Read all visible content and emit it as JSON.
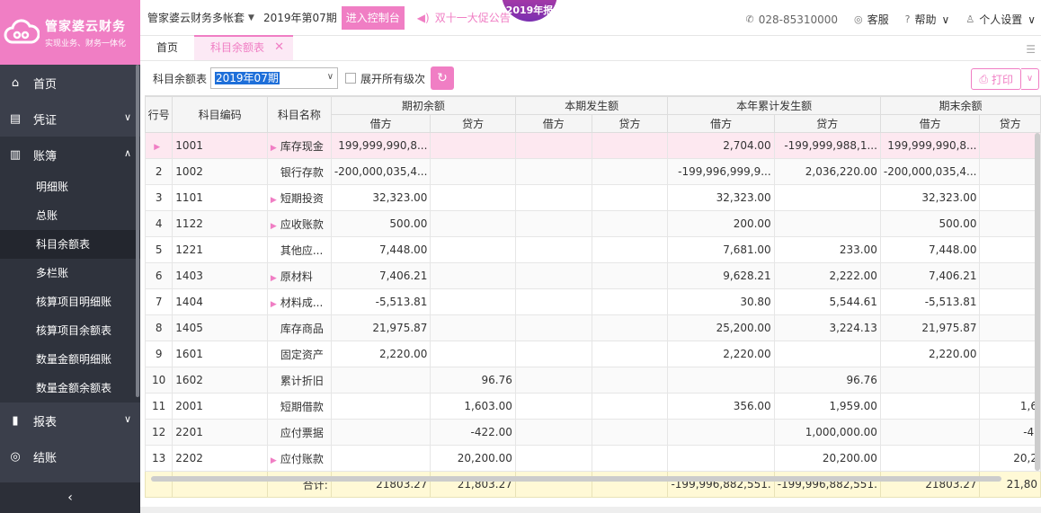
{
  "logo": {
    "title": "管家婆云财务",
    "slogan": "实现业务、财务一体化"
  },
  "sidebar": {
    "items": [
      {
        "label": "首页",
        "icon": "home-icon"
      },
      {
        "label": "凭证",
        "icon": "voucher-icon",
        "chevron": "∨"
      },
      {
        "label": "账簿",
        "icon": "ledger-icon",
        "chevron": "∧"
      }
    ],
    "ledger_sub": [
      "明细账",
      "总账",
      "科目余额表",
      "多栏账",
      "核算项目明细账",
      "核算项目余额表",
      "数量金额明细账",
      "数量金额余额表"
    ],
    "items_after": [
      {
        "label": "报表",
        "icon": "chart-icon",
        "chevron": "∨"
      },
      {
        "label": "结账",
        "icon": "close-account-icon"
      }
    ],
    "collapse": "‹"
  },
  "topbar": {
    "account": "管家婆云财务多帐套",
    "period": "2019年第07期",
    "enter_console": "进入控制台",
    "promo": "双十一大促公告",
    "badge": "2019年报",
    "phone": "028-85310000",
    "service": "客服",
    "help": "帮助",
    "settings": "个人设置"
  },
  "tabs": [
    {
      "label": "首页"
    },
    {
      "label": "科目余额表"
    }
  ],
  "toolbar": {
    "label": "科目余额表",
    "period_value": "2019年07期",
    "expand_label": "展开所有级次",
    "print": "打印"
  },
  "table": {
    "group_headers": [
      "行号",
      "科目编码",
      "科目名称",
      "期初余额",
      "本期发生额",
      "本年累计发生额",
      "期末余额"
    ],
    "sub_headers": [
      "借方",
      "贷方",
      "借方",
      "贷方",
      "借方",
      "贷方",
      "借方",
      "贷方"
    ],
    "rows": [
      {
        "no": "",
        "code": "1001",
        "name": "库存现金",
        "expand": true,
        "v": [
          "199,999,990,8...",
          "",
          "",
          "",
          "2,704.00",
          "-199,999,988,1...",
          "199,999,990,8...",
          ""
        ]
      },
      {
        "no": "2",
        "code": "1002",
        "name": "银行存款",
        "expand": false,
        "v": [
          "-200,000,035,4...",
          "",
          "",
          "",
          "-199,996,999,9...",
          "2,036,220.00",
          "-200,000,035,4...",
          ""
        ]
      },
      {
        "no": "3",
        "code": "1101",
        "name": "短期投资",
        "expand": true,
        "v": [
          "32,323.00",
          "",
          "",
          "",
          "32,323.00",
          "",
          "32,323.00",
          ""
        ]
      },
      {
        "no": "4",
        "code": "1122",
        "name": "应收账款",
        "expand": true,
        "v": [
          "500.00",
          "",
          "",
          "",
          "200.00",
          "",
          "500.00",
          ""
        ]
      },
      {
        "no": "5",
        "code": "1221",
        "name": "其他应...",
        "expand": false,
        "v": [
          "7,448.00",
          "",
          "",
          "",
          "7,681.00",
          "233.00",
          "7,448.00",
          ""
        ]
      },
      {
        "no": "6",
        "code": "1403",
        "name": "原材料",
        "expand": true,
        "v": [
          "7,406.21",
          "",
          "",
          "",
          "9,628.21",
          "2,222.00",
          "7,406.21",
          ""
        ]
      },
      {
        "no": "7",
        "code": "1404",
        "name": "材料成...",
        "expand": true,
        "v": [
          "-5,513.81",
          "",
          "",
          "",
          "30.80",
          "5,544.61",
          "-5,513.81",
          ""
        ]
      },
      {
        "no": "8",
        "code": "1405",
        "name": "库存商品",
        "expand": false,
        "v": [
          "21,975.87",
          "",
          "",
          "",
          "25,200.00",
          "3,224.13",
          "21,975.87",
          ""
        ]
      },
      {
        "no": "9",
        "code": "1601",
        "name": "固定资产",
        "expand": false,
        "v": [
          "2,220.00",
          "",
          "",
          "",
          "2,220.00",
          "",
          "2,220.00",
          ""
        ]
      },
      {
        "no": "10",
        "code": "1602",
        "name": "累计折旧",
        "expand": false,
        "v": [
          "",
          "96.76",
          "",
          "",
          "",
          "96.76",
          "",
          ""
        ]
      },
      {
        "no": "11",
        "code": "2001",
        "name": "短期借款",
        "expand": false,
        "v": [
          "",
          "1,603.00",
          "",
          "",
          "356.00",
          "1,959.00",
          "",
          "1,6"
        ]
      },
      {
        "no": "12",
        "code": "2201",
        "name": "应付票据",
        "expand": false,
        "v": [
          "",
          "-422.00",
          "",
          "",
          "",
          "1,000,000.00",
          "",
          "-4."
        ]
      },
      {
        "no": "13",
        "code": "2202",
        "name": "应付账款",
        "expand": true,
        "v": [
          "",
          "20,200.00",
          "",
          "",
          "",
          "20,200.00",
          "",
          "20,2"
        ]
      }
    ],
    "sum_label": "合计:",
    "sum": [
      "21803.27",
      "21,803.27",
      "",
      "",
      "-199,996,882,551.",
      "-199,996,882,551.",
      "21803.27",
      "21,80"
    ]
  }
}
